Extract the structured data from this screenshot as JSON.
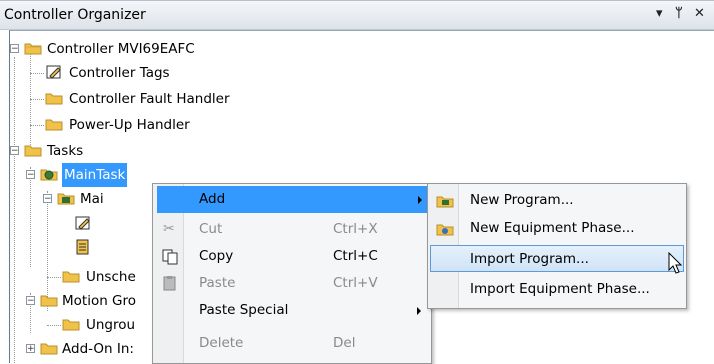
{
  "panel": {
    "title": "Controller Organizer",
    "pin_glyph": "▾ ᅟ",
    "buttons": {
      "dropdown": "▾",
      "pin": "ᛘ",
      "close": "✕"
    }
  },
  "tree": {
    "items": [
      {
        "label": "Controller MVI69EAFC",
        "icon": "folder-icon"
      },
      {
        "label": "Controller Tags",
        "icon": "tags-icon"
      },
      {
        "label": "Controller Fault Handler",
        "icon": "folder-icon"
      },
      {
        "label": "Power-Up Handler",
        "icon": "folder-icon"
      },
      {
        "label": "Tasks",
        "icon": "folder-icon"
      },
      {
        "label": "MainTask",
        "icon": "task-icon"
      },
      {
        "label": "Mai",
        "icon": "program-icon"
      },
      {
        "label": "Unsche",
        "icon": "folder-icon"
      },
      {
        "label": "Motion Gro",
        "icon": "folder-icon"
      },
      {
        "label": "Ungrou",
        "icon": "folder-icon"
      },
      {
        "label": "Add-On In:",
        "icon": "folder-icon"
      }
    ]
  },
  "context_menu": {
    "items": [
      {
        "label": "Add",
        "shortcut": ""
      },
      {
        "label": "Cut",
        "shortcut": "Ctrl+X"
      },
      {
        "label": "Copy",
        "shortcut": "Ctrl+C"
      },
      {
        "label": "Paste",
        "shortcut": "Ctrl+V"
      },
      {
        "label": "Paste Special",
        "shortcut": ""
      },
      {
        "label": "Delete",
        "shortcut": "Del"
      }
    ]
  },
  "submenu": {
    "items": [
      {
        "label": "New Program..."
      },
      {
        "label": "New Equipment Phase..."
      },
      {
        "label": "Import Program..."
      },
      {
        "label": "Import Equipment Phase..."
      }
    ]
  },
  "colors": {
    "selection": "#3399ff",
    "menu_bg": "#f5f6f7",
    "folder": "#f0c24a"
  }
}
